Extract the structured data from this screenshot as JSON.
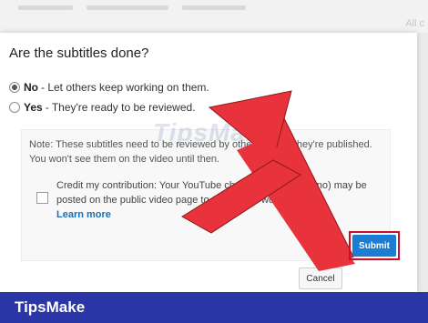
{
  "background": {
    "right_text": "All c"
  },
  "dialog": {
    "title": "Are the subtitles done?",
    "options": [
      {
        "bold": "No",
        "text": "- Let others keep working on them.",
        "checked": true
      },
      {
        "bold": "Yes",
        "text": "- They're ready to be reviewed.",
        "checked": false
      }
    ],
    "note": "Note: These subtitles need to be reviewed by others before they're published. You won't see them on the video until then.",
    "credit": {
      "text": "Credit my contribution: Your YouTube channel name (Soriano) may be posted on the public video page to credit your work.",
      "link": "Learn more",
      "checked": false
    },
    "cancel_label": "Cancel",
    "submit_label": "Submit"
  },
  "watermark": "TipsMake",
  "footer": {
    "brand": "TipsMake"
  },
  "colors": {
    "arrow": "#e8323c",
    "submit": "#1b7cd1",
    "footer": "#2a36a6"
  }
}
